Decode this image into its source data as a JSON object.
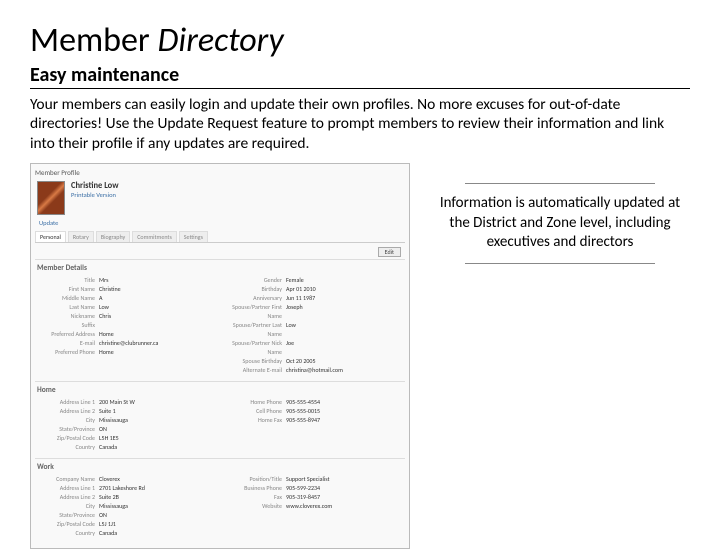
{
  "title_plain": "Member ",
  "title_italic": "Directory",
  "subtitle": "Easy maintenance",
  "body": "Your members can easily login and update their own profiles. No more excuses for out-of-date directories! Use the Update Request feature to prompt members to review their information and link into their profile if any updates are required.",
  "callout": "Information is automatically updated at the District and Zone level, including executives and directors",
  "profile": {
    "crumb": "Member Profile",
    "name": "Christine Low",
    "sub": "Printable Version",
    "update": "Update",
    "tabs": [
      "Personal",
      "Rotary",
      "Biography",
      "Commitments",
      "Settings"
    ],
    "edit": "Edit",
    "member_details": {
      "heading": "Member Details",
      "left": [
        {
          "k": "Title",
          "v": "Mrs"
        },
        {
          "k": "First Name",
          "v": "Christine"
        },
        {
          "k": "Middle Name",
          "v": "A"
        },
        {
          "k": "Last Name",
          "v": "Low"
        },
        {
          "k": "Nickname",
          "v": "Chris"
        },
        {
          "k": "Suffix",
          "v": ""
        },
        {
          "k": "Preferred Address",
          "v": "Home"
        },
        {
          "k": "E-mail",
          "v": "christine@clubrunner.ca"
        },
        {
          "k": "Preferred Phone",
          "v": "Home"
        }
      ],
      "right": [
        {
          "k": "Gender",
          "v": "Female"
        },
        {
          "k": "Birthday",
          "v": "Apr 01 2010"
        },
        {
          "k": "Anniversary",
          "v": "Jun 11 1987"
        },
        {
          "k": "Spouse/Partner First Name",
          "v": "Joseph"
        },
        {
          "k": "Spouse/Partner Last Name",
          "v": "Low"
        },
        {
          "k": "Spouse/Partner Nick Name",
          "v": "Joe"
        },
        {
          "k": "Spouse Birthday",
          "v": "Oct 20 2005"
        },
        {
          "k": "Alternate E-mail",
          "v": "christina@hotmail.com"
        }
      ]
    },
    "home": {
      "heading": "Home",
      "left": [
        {
          "k": "Address Line 1",
          "v": "200 Main St W"
        },
        {
          "k": "Address Line 2",
          "v": "Suite 1"
        },
        {
          "k": "City",
          "v": "Mississauga"
        },
        {
          "k": "State/Province",
          "v": "ON"
        },
        {
          "k": "Zip/Postal Code",
          "v": "L5H 1E5"
        },
        {
          "k": "Country",
          "v": "Canada"
        }
      ],
      "right": [
        {
          "k": "Home Phone",
          "v": "905-555-4554"
        },
        {
          "k": "Cell Phone",
          "v": "905-555-0015"
        },
        {
          "k": "Home Fax",
          "v": "905-555-8947"
        }
      ]
    },
    "work": {
      "heading": "Work",
      "left": [
        {
          "k": "Company Name",
          "v": "Cloverex"
        },
        {
          "k": "Address Line 1",
          "v": "2701 Lakeshore Rd"
        },
        {
          "k": "Address Line 2",
          "v": "Suite 2B"
        },
        {
          "k": "City",
          "v": "Mississauga"
        },
        {
          "k": "State/Province",
          "v": "ON"
        },
        {
          "k": "Zip/Postal Code",
          "v": "L5J 1J1"
        },
        {
          "k": "Country",
          "v": "Canada"
        }
      ],
      "right": [
        {
          "k": "Position/Title",
          "v": "Support Specialist"
        },
        {
          "k": "Business Phone",
          "v": "905-599-2234"
        },
        {
          "k": "Fax",
          "v": "905-319-8457"
        },
        {
          "k": "Website",
          "v": "www.cloverex.com"
        }
      ]
    }
  }
}
